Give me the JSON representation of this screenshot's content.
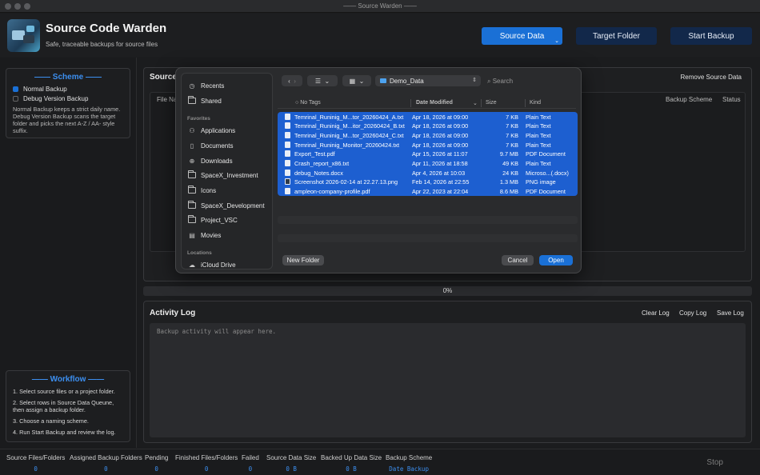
{
  "window": {
    "title": "—— Source Warden ——"
  },
  "header": {
    "title": "Source Code Warden",
    "subtitle": "Safe, traceable backups for source files",
    "buttons": {
      "source_data": "Source Data",
      "target_folder": "Target Folder",
      "start_backup": "Start Backup"
    },
    "accent_color": "#1a70d6"
  },
  "scheme": {
    "title": "—— Scheme ——",
    "options": [
      "Normal Backup",
      "Debug Version Backup"
    ],
    "selected": "Normal Backup",
    "description": "Normal Backup keeps a strict daily name. Debug Version Backup scans the target folder and picks the next A-Z / AA- style suffix."
  },
  "workflow": {
    "title": "—— Workflow ——",
    "steps": [
      "1. Select source files or a project folder.",
      "2. Select rows in Source Data Queune, then assign a backup folder.",
      "3. Choose a naming scheme.",
      "4. Run Start Backup and review the log."
    ]
  },
  "source_panel": {
    "title": "Source",
    "remove_label": "Remove Source Data",
    "columns": [
      "File Na",
      "Backup Scheme",
      "Status"
    ]
  },
  "progress": {
    "label": "0%",
    "value": 0
  },
  "activity_log": {
    "title": "Activity Log",
    "buttons": [
      "Clear Log",
      "Copy Log",
      "Save Log"
    ],
    "placeholder": "Backup activity will appear here."
  },
  "status_bar": {
    "stats": [
      {
        "label": "Source Files/Folders",
        "value": "0"
      },
      {
        "label": "Assigned Backup Folders",
        "value": "0"
      },
      {
        "label": "Pending",
        "value": "0"
      },
      {
        "label": "Finished Files/Folders",
        "value": "0"
      },
      {
        "label": "Failed",
        "value": "0"
      },
      {
        "label": "Source Data Size",
        "value": "0 B"
      },
      {
        "label": "Backed Up Data Size",
        "value": "0 B"
      },
      {
        "label": "Backup Scheme",
        "value": "Date Backup"
      }
    ],
    "stop_label": "Stop"
  },
  "file_dialog": {
    "sidebar": {
      "top_items": [
        "Recents",
        "Shared"
      ],
      "favorites_heading": "Favorites",
      "favorites": [
        "Applications",
        "Documents",
        "Downloads",
        "SpaceX_Investment",
        "Icons",
        "SpaceX_Development",
        "Project_VSC",
        "Movies"
      ],
      "locations_heading": "Locations",
      "locations": [
        "iCloud Drive"
      ]
    },
    "path": "Demo_Data",
    "search_placeholder": "Search",
    "columns": {
      "tag": "No Tags",
      "date": "Date Modified",
      "size": "Size",
      "kind": "Kind"
    },
    "files": [
      {
        "name": "Temrinal_Runinig_M...tor_20260424_A.txt",
        "date": "Apr 18, 2026 at 09:00",
        "size": "7 KB",
        "kind": "Plain Text",
        "icon": "text-file-icon"
      },
      {
        "name": "Temrinal_Runinig_M...itor_20260424_B.txt",
        "date": "Apr 18, 2026 at 09:00",
        "size": "7 KB",
        "kind": "Plain Text",
        "icon": "text-file-icon"
      },
      {
        "name": "Temrinal_Runinig_M...tor_20260424_C.txt",
        "date": "Apr 18, 2026 at 09:00",
        "size": "7 KB",
        "kind": "Plain Text",
        "icon": "text-file-icon"
      },
      {
        "name": "Temrinal_Runinig_Monitor_20260424.txt",
        "date": "Apr 18, 2026 at 09:00",
        "size": "7 KB",
        "kind": "Plain Text",
        "icon": "text-file-icon"
      },
      {
        "name": "Export_Test.pdf",
        "date": "Apr 15, 2026 at 11:07",
        "size": "9.7 MB",
        "kind": "PDF Document",
        "icon": "pdf-file-icon"
      },
      {
        "name": "Crash_report_x86.txt",
        "date": "Apr 11, 2026 at 18:58",
        "size": "49 KB",
        "kind": "Plain Text",
        "icon": "text-file-icon"
      },
      {
        "name": "debug_Notes.docx",
        "date": "Apr 4, 2026 at 10:03",
        "size": "24 KB",
        "kind": "Microso...(.docx)",
        "icon": "doc-file-icon"
      },
      {
        "name": "Screenshot 2026-02-14 at 22.27.13.png",
        "date": "Feb 14, 2026 at 22:55",
        "size": "1.3 MB",
        "kind": "PNG image",
        "icon": "image-file-icon"
      },
      {
        "name": "ampleon-company-profile.pdf",
        "date": "Apr 22, 2023 at 22:04",
        "size": "8.6 MB",
        "kind": "PDF Document",
        "icon": "pdf-file-icon"
      }
    ],
    "buttons": {
      "new_folder": "New Folder",
      "cancel": "Cancel",
      "open": "Open"
    },
    "selection_color": "#1d5fd0"
  }
}
